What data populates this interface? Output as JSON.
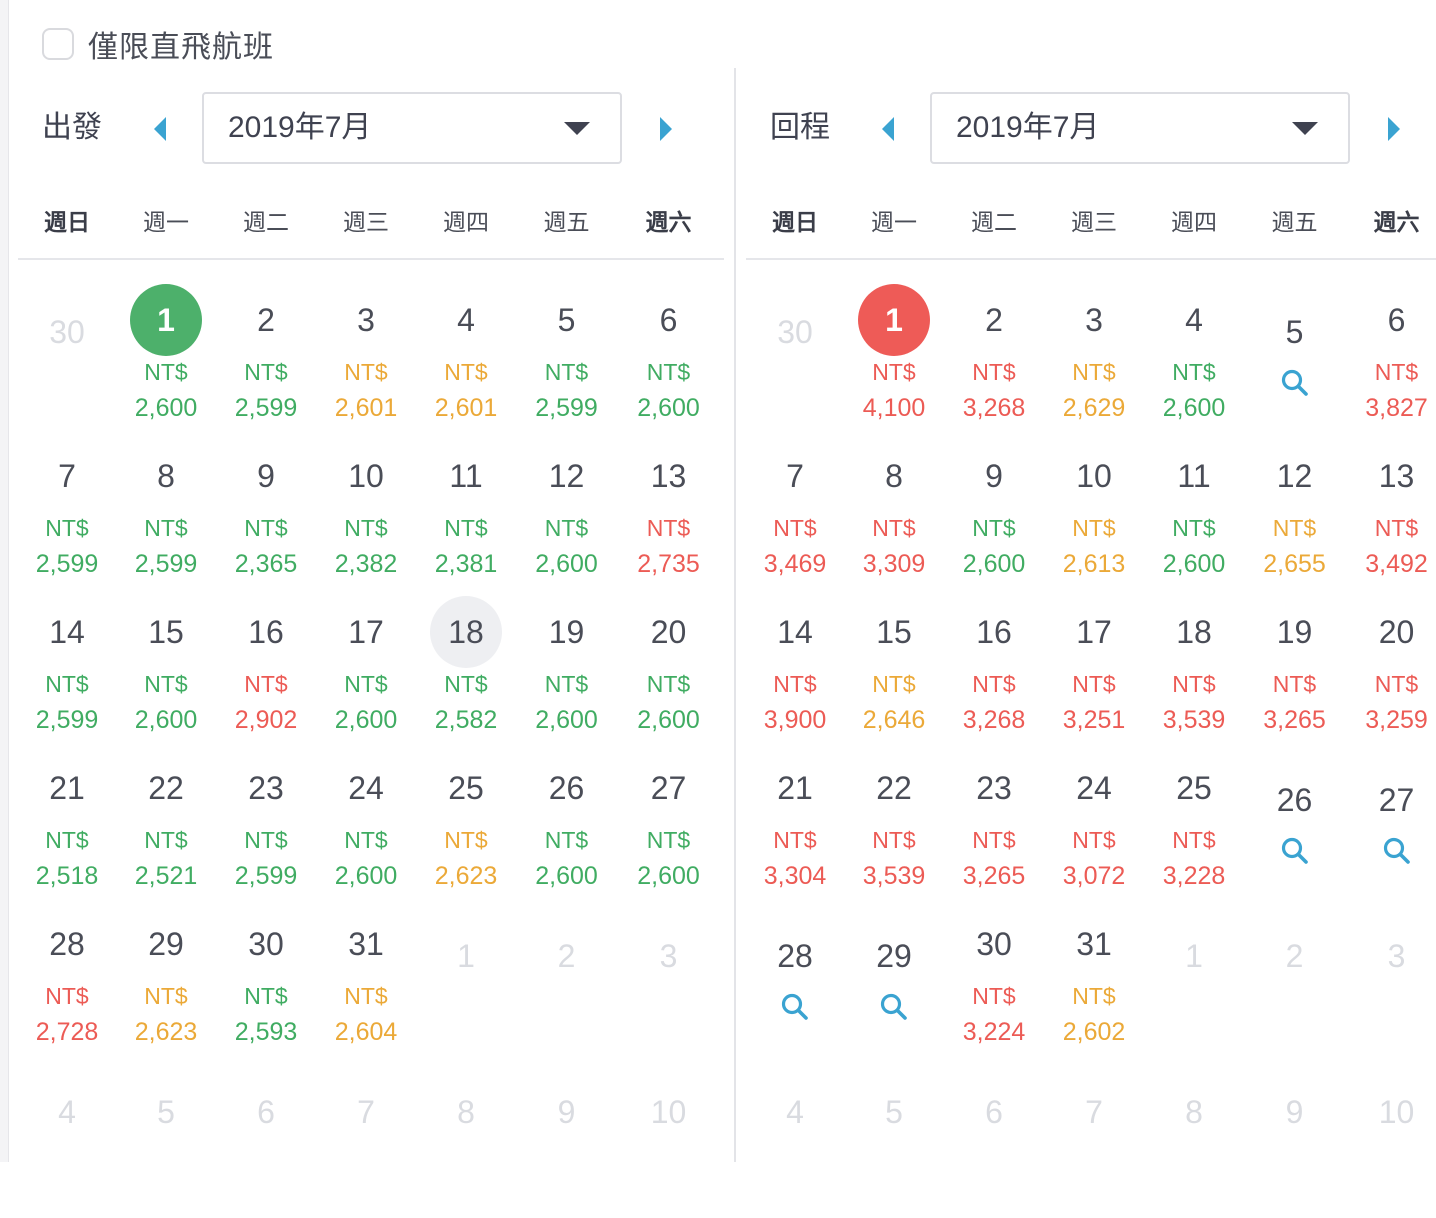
{
  "direct_only": {
    "label": "僅限直飛航班",
    "checked": false
  },
  "weekdays": [
    "週日",
    "週一",
    "週二",
    "週三",
    "週四",
    "週五",
    "週六"
  ],
  "currency": "NT$",
  "colors": {
    "green": "#40ac62",
    "orange": "#eba938",
    "red": "#ec5b55",
    "search": "#3aa3d1",
    "arrow": "#3aa3d1"
  },
  "departure": {
    "label": "出發",
    "month": "2019年7月",
    "selected_day": "1",
    "weeks": [
      [
        {
          "day": "30",
          "other": true
        },
        {
          "day": "1",
          "price": "2,600",
          "level": "green",
          "highlight": "green"
        },
        {
          "day": "2",
          "price": "2,599",
          "level": "green"
        },
        {
          "day": "3",
          "price": "2,601",
          "level": "orange"
        },
        {
          "day": "4",
          "price": "2,601",
          "level": "orange"
        },
        {
          "day": "5",
          "price": "2,599",
          "level": "green"
        },
        {
          "day": "6",
          "price": "2,600",
          "level": "green"
        }
      ],
      [
        {
          "day": "7",
          "price": "2,599",
          "level": "green"
        },
        {
          "day": "8",
          "price": "2,599",
          "level": "green"
        },
        {
          "day": "9",
          "price": "2,365",
          "level": "green"
        },
        {
          "day": "10",
          "price": "2,382",
          "level": "green"
        },
        {
          "day": "11",
          "price": "2,381",
          "level": "green"
        },
        {
          "day": "12",
          "price": "2,600",
          "level": "green"
        },
        {
          "day": "13",
          "price": "2,735",
          "level": "red"
        }
      ],
      [
        {
          "day": "14",
          "price": "2,599",
          "level": "green"
        },
        {
          "day": "15",
          "price": "2,600",
          "level": "green"
        },
        {
          "day": "16",
          "price": "2,902",
          "level": "red"
        },
        {
          "day": "17",
          "price": "2,600",
          "level": "green"
        },
        {
          "day": "18",
          "price": "2,582",
          "level": "green",
          "highlight": "grey"
        },
        {
          "day": "19",
          "price": "2,600",
          "level": "green"
        },
        {
          "day": "20",
          "price": "2,600",
          "level": "green"
        }
      ],
      [
        {
          "day": "21",
          "price": "2,518",
          "level": "green"
        },
        {
          "day": "22",
          "price": "2,521",
          "level": "green"
        },
        {
          "day": "23",
          "price": "2,599",
          "level": "green"
        },
        {
          "day": "24",
          "price": "2,600",
          "level": "green"
        },
        {
          "day": "25",
          "price": "2,623",
          "level": "orange"
        },
        {
          "day": "26",
          "price": "2,600",
          "level": "green"
        },
        {
          "day": "27",
          "price": "2,600",
          "level": "green"
        }
      ],
      [
        {
          "day": "28",
          "price": "2,728",
          "level": "red"
        },
        {
          "day": "29",
          "price": "2,623",
          "level": "orange"
        },
        {
          "day": "30",
          "price": "2,593",
          "level": "green"
        },
        {
          "day": "31",
          "price": "2,604",
          "level": "orange"
        },
        {
          "day": "1",
          "other": true
        },
        {
          "day": "2",
          "other": true
        },
        {
          "day": "3",
          "other": true
        }
      ],
      [
        {
          "day": "4",
          "other": true
        },
        {
          "day": "5",
          "other": true
        },
        {
          "day": "6",
          "other": true
        },
        {
          "day": "7",
          "other": true
        },
        {
          "day": "8",
          "other": true
        },
        {
          "day": "9",
          "other": true
        },
        {
          "day": "10",
          "other": true
        }
      ]
    ]
  },
  "return": {
    "label": "回程",
    "month": "2019年7月",
    "selected_day": "1",
    "weeks": [
      [
        {
          "day": "30",
          "other": true
        },
        {
          "day": "1",
          "price": "4,100",
          "level": "red",
          "highlight": "red"
        },
        {
          "day": "2",
          "price": "3,268",
          "level": "red"
        },
        {
          "day": "3",
          "price": "2,629",
          "level": "orange"
        },
        {
          "day": "4",
          "price": "2,600",
          "level": "green"
        },
        {
          "day": "5",
          "search": true
        },
        {
          "day": "6",
          "price": "3,827",
          "level": "red"
        }
      ],
      [
        {
          "day": "7",
          "price": "3,469",
          "level": "red"
        },
        {
          "day": "8",
          "price": "3,309",
          "level": "red"
        },
        {
          "day": "9",
          "price": "2,600",
          "level": "green"
        },
        {
          "day": "10",
          "price": "2,613",
          "level": "orange"
        },
        {
          "day": "11",
          "price": "2,600",
          "level": "green"
        },
        {
          "day": "12",
          "price": "2,655",
          "level": "orange"
        },
        {
          "day": "13",
          "price": "3,492",
          "level": "red"
        }
      ],
      [
        {
          "day": "14",
          "price": "3,900",
          "level": "red"
        },
        {
          "day": "15",
          "price": "2,646",
          "level": "orange"
        },
        {
          "day": "16",
          "price": "3,268",
          "level": "red"
        },
        {
          "day": "17",
          "price": "3,251",
          "level": "red"
        },
        {
          "day": "18",
          "price": "3,539",
          "level": "red"
        },
        {
          "day": "19",
          "price": "3,265",
          "level": "red"
        },
        {
          "day": "20",
          "price": "3,259",
          "level": "red"
        }
      ],
      [
        {
          "day": "21",
          "price": "3,304",
          "level": "red"
        },
        {
          "day": "22",
          "price": "3,539",
          "level": "red"
        },
        {
          "day": "23",
          "price": "3,265",
          "level": "red"
        },
        {
          "day": "24",
          "price": "3,072",
          "level": "red"
        },
        {
          "day": "25",
          "price": "3,228",
          "level": "red"
        },
        {
          "day": "26",
          "search": true
        },
        {
          "day": "27",
          "search": true
        }
      ],
      [
        {
          "day": "28",
          "search": true
        },
        {
          "day": "29",
          "search": true
        },
        {
          "day": "30",
          "price": "3,224",
          "level": "red"
        },
        {
          "day": "31",
          "price": "2,602",
          "level": "orange"
        },
        {
          "day": "1",
          "other": true
        },
        {
          "day": "2",
          "other": true
        },
        {
          "day": "3",
          "other": true
        }
      ],
      [
        {
          "day": "4",
          "other": true
        },
        {
          "day": "5",
          "other": true
        },
        {
          "day": "6",
          "other": true
        },
        {
          "day": "7",
          "other": true
        },
        {
          "day": "8",
          "other": true
        },
        {
          "day": "9",
          "other": true
        },
        {
          "day": "10",
          "other": true
        }
      ]
    ]
  }
}
